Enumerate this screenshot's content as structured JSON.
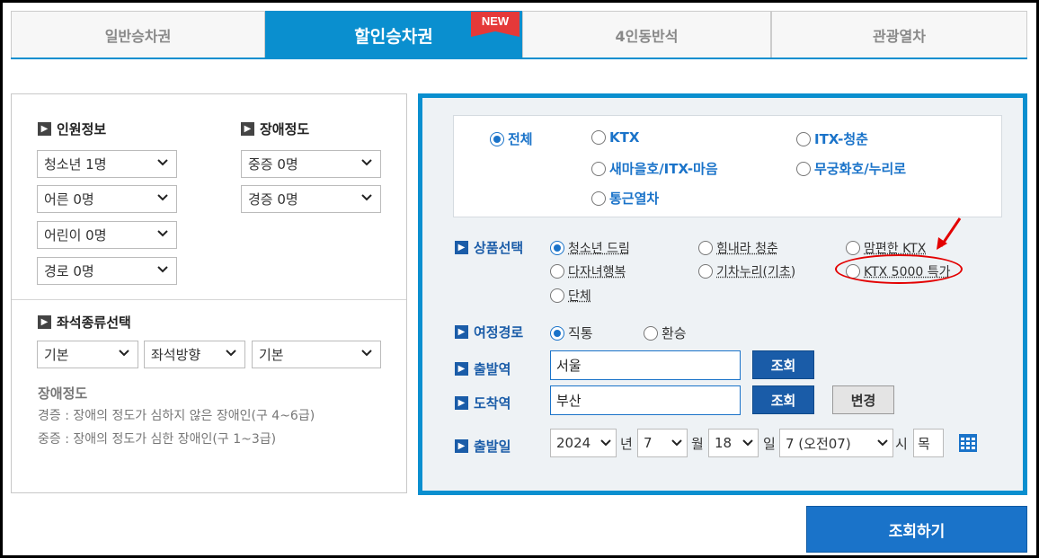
{
  "tabs": [
    {
      "label": "일반승차권"
    },
    {
      "label": "할인승차권",
      "badge": "NEW"
    },
    {
      "label": "4인동반석"
    },
    {
      "label": "관광열차"
    }
  ],
  "passenger_info": {
    "title": "인원정보",
    "selects": [
      "청소년 1명",
      "어른 0명",
      "어린이 0명",
      "경로 0명"
    ]
  },
  "disability": {
    "title": "장애정도",
    "selects": [
      "중증 0명",
      "경증 0명"
    ]
  },
  "seat_type": {
    "title": "좌석종류선택",
    "selects": [
      "기본",
      "좌석방향",
      "기본"
    ]
  },
  "disability_note": {
    "title": "장애정도",
    "lines": [
      "경증 : 장애의 정도가 심하지 않은 장애인(구 4~6급)",
      "중증 : 장애의 정도가 심한 장애인(구 1~3급)"
    ]
  },
  "train_types": [
    {
      "label": "전체",
      "checked": true
    },
    {
      "label": "KTX"
    },
    {
      "label": "ITX-청춘"
    },
    {
      "label": "새마을호/ITX-마음"
    },
    {
      "label": "무궁화호/누리로"
    },
    {
      "label": "통근열차"
    }
  ],
  "product": {
    "label": "상품선택",
    "options": [
      {
        "label": "청소년 드림",
        "checked": true
      },
      {
        "label": "힘내라 청춘"
      },
      {
        "label": "맘편한 KTX"
      },
      {
        "label": "다자녀행복"
      },
      {
        "label": "기차누리(기초)"
      },
      {
        "label": "KTX 5000 특가"
      },
      {
        "label": "단체"
      }
    ]
  },
  "route": {
    "label": "여정경로",
    "options": [
      {
        "label": "직통",
        "checked": true
      },
      {
        "label": "환승"
      }
    ]
  },
  "departure": {
    "label": "출발역",
    "value": "서울",
    "button": "조회"
  },
  "arrival": {
    "label": "도착역",
    "value": "부산",
    "button": "조회",
    "change_button": "변경"
  },
  "date": {
    "label": "출발일",
    "year": "2024",
    "year_unit": "년",
    "month": "7",
    "month_unit": "월",
    "day": "18",
    "day_unit": "일",
    "hour": "7 (오전07)",
    "hour_unit": "시",
    "weekday": "목"
  },
  "search_button": "조회하기",
  "colors": {
    "accent": "#0a8fcf",
    "annotation": "#e30000"
  }
}
